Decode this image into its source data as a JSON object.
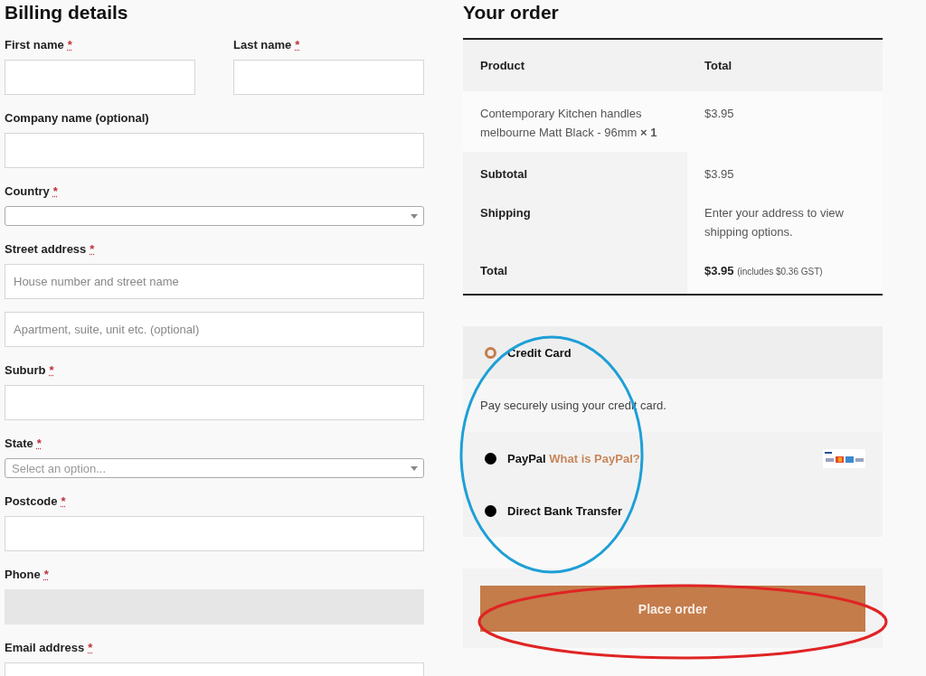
{
  "billing": {
    "title": "Billing details",
    "fields": [
      {
        "label": "First name",
        "required_mark": "*",
        "kind": "text",
        "disabled": false
      },
      {
        "label": "Last name",
        "required_mark": "*",
        "kind": "text",
        "disabled": false
      },
      {
        "label": "Company name (optional)",
        "kind": "text",
        "disabled": false
      },
      {
        "label": "Country",
        "required_mark": "*",
        "kind": "select",
        "disabled": false
      },
      {
        "label": "Street address",
        "required_mark": "*",
        "kind": "text",
        "placeholder": "House number and street name",
        "disabled": false
      },
      {
        "kind": "text",
        "placeholder": "Apartment, suite, unit etc. (optional)",
        "disabled": false
      },
      {
        "label": "Suburb",
        "required_mark": "*",
        "kind": "text",
        "disabled": false
      },
      {
        "label": "State",
        "required_mark": "*",
        "kind": "select",
        "placeholder": "Select an option...",
        "disabled": false
      },
      {
        "label": "Postcode",
        "required_mark": "*",
        "kind": "text",
        "disabled": false
      },
      {
        "label": "Phone",
        "required_mark": "*",
        "kind": "text",
        "disabled": true
      },
      {
        "label": "Email address",
        "required_mark": "*",
        "kind": "text",
        "disabled": false
      }
    ]
  },
  "order": {
    "title": "Your order",
    "table": {
      "columns": [
        "Product",
        "Total"
      ],
      "items": [
        {
          "product": "Contemporary Kitchen handles melbourne Matt Black - 96mm  **× 1**",
          "total": "$3.95"
        }
      ],
      "totals": [
        {
          "label": "Subtotal",
          "value": "$3.95"
        },
        {
          "label": "Shipping",
          "value": "Enter your address to view shipping options."
        },
        {
          "label": "Total",
          "value": "$3.95",
          "note": "(includes $0.36 GST)"
        }
      ]
    },
    "payment_methods": [
      {
        "label": "Credit Card",
        "selected": true,
        "description": "Pay securely using your credit card."
      },
      {
        "label": "PayPal",
        "selected": false,
        "link": "What is PayPal?",
        "logos": true
      },
      {
        "label": "Direct Bank Transfer",
        "selected": false
      }
    ],
    "place_order": "Place order"
  },
  "annotations": [
    {
      "color": "#1e9fd6"
    },
    {
      "color": "#e02424"
    }
  ]
}
